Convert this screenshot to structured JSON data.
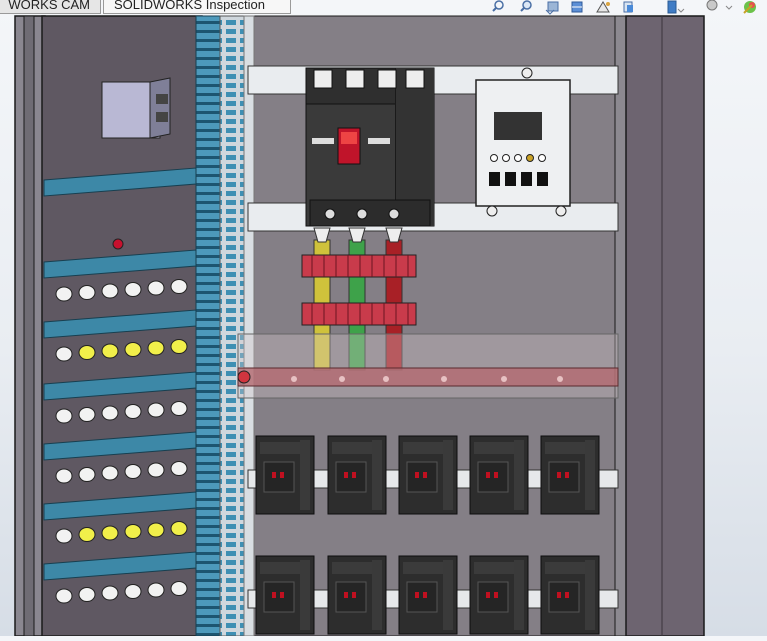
{
  "app": {
    "name": "SOLIDWORKS"
  },
  "tabs": [
    {
      "label": "WORKS CAM",
      "active": false
    },
    {
      "label": "SOLIDWORKS Inspection",
      "active": true
    }
  ],
  "heads_up_toolbar": [
    "zoom-to-fit-icon",
    "zoom-to-area-icon",
    "previous-view-icon",
    "section-view-icon",
    "dynamic-annotation-view-icon",
    "view-orientation-icon",
    "display-style-icon",
    "hide-show-items-icon",
    "edit-appearance-icon"
  ],
  "colors": {
    "cabinet": "#7d7a80",
    "backplate": "#5d5660",
    "din_rail_blue": "#3d88a7",
    "wire_duct": "#4a96b8",
    "breaker": "#3c3c3c",
    "breaker_handle": "#c0142a",
    "label_strip": "#c93b4b",
    "busbar_yellow": "#cfc23b",
    "busbar_green": "#3ea24a",
    "busbar_red": "#a82026",
    "relay_body": "#2d2d2d",
    "pilot_lamp_yellow": "#f1ef4a"
  }
}
